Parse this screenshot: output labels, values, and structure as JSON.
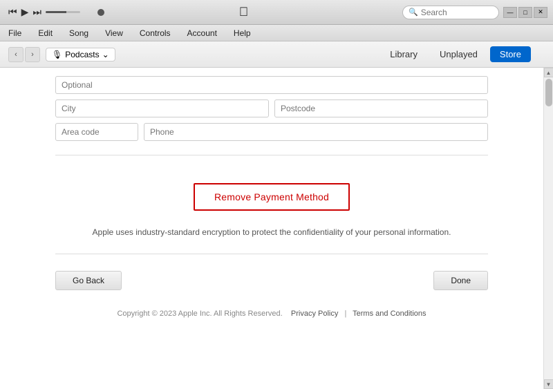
{
  "titlebar": {
    "transport": {
      "rewind": "⏮",
      "play": "▶",
      "forward": "⏭"
    },
    "apple_logo": "",
    "search_placeholder": "Search",
    "window_buttons": {
      "minimize": "—",
      "maximize": "□",
      "close": "✕"
    }
  },
  "menubar": {
    "items": [
      "File",
      "Edit",
      "Song",
      "View",
      "Controls",
      "Account",
      "Help"
    ]
  },
  "navbar": {
    "back_arrow": "‹",
    "forward_arrow": "›",
    "podcast_icon": "🎙",
    "podcast_label": "Podcasts",
    "podcast_arrow": "⌄",
    "tabs": [
      {
        "label": "Library",
        "active": false
      },
      {
        "label": "Unplayed",
        "active": false
      },
      {
        "label": "Store",
        "active": true
      }
    ]
  },
  "form": {
    "optional_placeholder": "Optional",
    "city_placeholder": "City",
    "postcode_placeholder": "Postcode",
    "area_code_placeholder": "Area code",
    "phone_placeholder": "Phone"
  },
  "remove_payment": {
    "button_label": "Remove Payment Method"
  },
  "encryption_notice": "Apple uses industry-standard encryption to protect the confidentiality of your personal information.",
  "action_buttons": {
    "go_back_label": "Go Back",
    "done_label": "Done"
  },
  "footer": {
    "copyright": "Copyright © 2023 Apple Inc. All Rights Reserved.",
    "privacy_label": "Privacy Policy",
    "separator": "|",
    "terms_label": "Terms and Conditions"
  }
}
